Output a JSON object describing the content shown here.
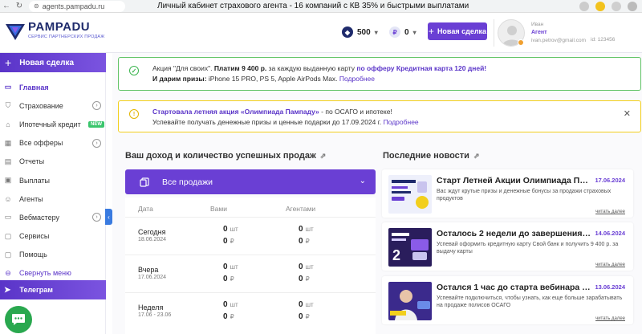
{
  "browser": {
    "url": "agents.pampadu.ru",
    "tab_title": "Личный кабинет страхового агента - 16 компаний с КВ 35% и быстрыми выплатами"
  },
  "header": {
    "logo_name": "PAMPADU",
    "logo_subtitle": "СЕРВИС ПАРТНЕРСКИХ ПРОДАЖ",
    "balance_shield": "500",
    "balance_rub": "0",
    "rub_symbol": "₽",
    "new_deal_label": "Новая сделка",
    "user_name": "Иван",
    "user_role": "Агент",
    "user_email": "ivan.petrov@gmail.com",
    "user_id": "id: 123456"
  },
  "sidebar": {
    "new_deal_label": "Новая сделка",
    "items": [
      {
        "label": "Главная",
        "icon": "monitor-icon"
      },
      {
        "label": "Страхование",
        "icon": "shield-icon"
      },
      {
        "label": "Ипотечный кредит",
        "icon": "house-icon",
        "badge": "NEW"
      },
      {
        "label": "Все офферы",
        "icon": "grid-icon"
      },
      {
        "label": "Отчеты",
        "icon": "document-icon"
      },
      {
        "label": "Выплаты",
        "icon": "wallet-icon"
      },
      {
        "label": "Агенты",
        "icon": "users-icon"
      },
      {
        "label": "Вебмастеру",
        "icon": "code-icon"
      },
      {
        "label": "Сервисы",
        "icon": "window-icon"
      },
      {
        "label": "Помощь",
        "icon": "help-icon"
      },
      {
        "label": "Свернуть меню",
        "icon": "collapse-icon"
      }
    ],
    "telegram_label": "Телеграм"
  },
  "banners": {
    "green": {
      "line1_prefix": "Акция \"Для своих\". ",
      "line1_bold": "Платим 9 400 р.",
      "line1_mid": " за каждую выданную карту ",
      "line1_offer": "по офферу Кредитная карта 120 дней!",
      "line2_bold": "И дарим призы:",
      "line2_text": " iPhone 15 PRO, PS 5, Apple AirPods Max. ",
      "line2_link": "Подробнее"
    },
    "yellow": {
      "line1_purple": "Стартовала летняя акция «Олимпиада Пампаду»",
      "line1_text": " - по ОСАГО и ипотеке!",
      "line2_text": "Успевайте получать денежные призы и ценные подарки до 17.09.2024 г. ",
      "line2_link": "Подробнее"
    }
  },
  "income": {
    "title": "Ваш доход и количество успешных продаж",
    "dropdown_label": "Все продажи",
    "columns": [
      "Дата",
      "Вами",
      "Агентами"
    ],
    "unit_count": "шт",
    "unit_money": "₽",
    "rows": [
      {
        "period": "Сегодня",
        "date": "18.06.2024",
        "self_count": "0",
        "self_money": "0",
        "agents_count": "0",
        "agents_money": "0"
      },
      {
        "period": "Вчера",
        "date": "17.06.2024",
        "self_count": "0",
        "self_money": "0",
        "agents_count": "0",
        "agents_money": "0"
      },
      {
        "period": "Неделя",
        "date": "17.06 - 23.06",
        "self_count": "0",
        "self_money": "0",
        "agents_count": "0",
        "agents_money": "0"
      }
    ]
  },
  "news": {
    "title": "Последние новости",
    "more_label": "читать далее",
    "items": [
      {
        "title": "Старт Летней Акции Олимпиада Пампаду",
        "date": "17.06.2024",
        "text": "Вас ждут крутые призы и денежные бонусы за продажи страховых продуктов"
      },
      {
        "title": "Осталось 2 недели до завершения акции",
        "date": "14.06.2024",
        "text": "Успевай оформить кредитную карту Свой банк и получить 9 400 р. за выдачу карты"
      },
      {
        "title": "Остался 1 час до старта вебинара по ОСАГО",
        "date": "13.06.2024",
        "text": "Успевайте подключиться, чтобы узнать, как еще больше зарабатывать на продаже полисов ОСАГО"
      }
    ]
  },
  "colors": {
    "accent": "#6a3fd4",
    "green_border": "#62c467",
    "yellow_border": "#f2cf1d",
    "new_badge": "#3ac56c"
  }
}
